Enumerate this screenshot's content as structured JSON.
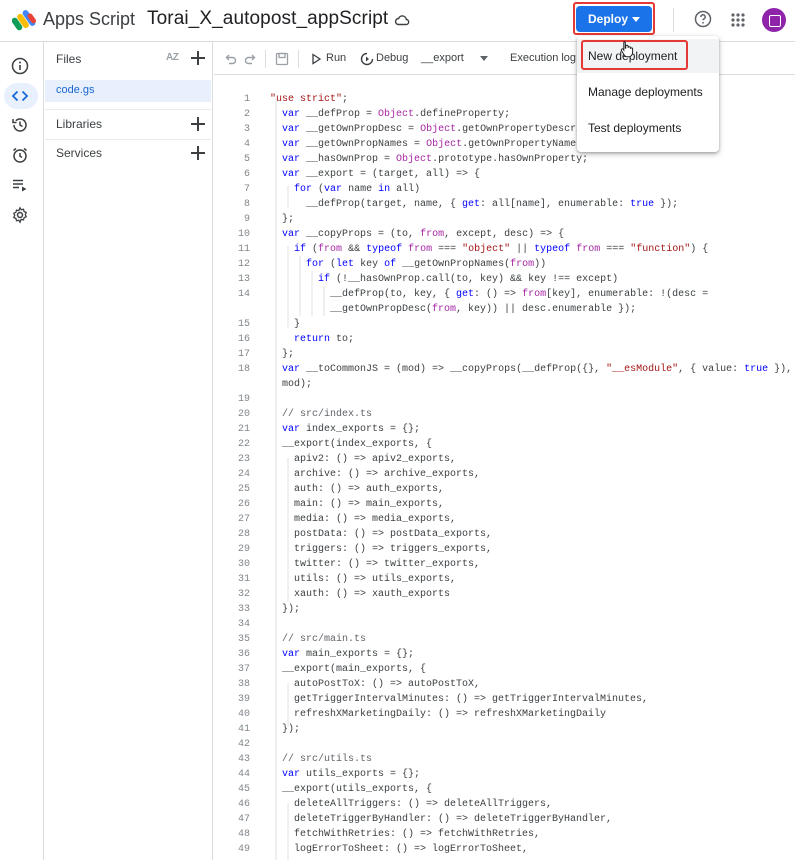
{
  "header": {
    "app_name": "Apps Script",
    "project_title": "Torai_X_autopost_appScript",
    "deploy_label": "Deploy"
  },
  "deploy_menu": {
    "items": [
      "New deployment",
      "Manage deployments",
      "Test deployments"
    ]
  },
  "files_panel": {
    "files_label": "Files",
    "sort_label": "AZ",
    "files": [
      "code.gs"
    ],
    "libraries_label": "Libraries",
    "services_label": "Services"
  },
  "toolbar": {
    "run_label": "Run",
    "debug_label": "Debug",
    "function_selected": "__export",
    "execution_log_label": "Execution log"
  },
  "editor": {
    "lines": [
      {
        "n": "1",
        "t": "\"use strict\";"
      },
      {
        "n": "2",
        "t": "  var __defProp = Object.defineProperty;"
      },
      {
        "n": "3",
        "t": "  var __getOwnPropDesc = Object.getOwnPropertyDescrip"
      },
      {
        "n": "4",
        "t": "  var __getOwnPropNames = Object.getOwnPropertyNames"
      },
      {
        "n": "5",
        "t": "  var __hasOwnProp = Object.prototype.hasOwnProperty;"
      },
      {
        "n": "6",
        "t": "  var __export = (target, all) => {"
      },
      {
        "n": "7",
        "t": "    for (var name in all)"
      },
      {
        "n": "8",
        "t": "      __defProp(target, name, { get: all[name], enumerable: true });"
      },
      {
        "n": "9",
        "t": "  };"
      },
      {
        "n": "10",
        "t": "  var __copyProps = (to, from, except, desc) => {"
      },
      {
        "n": "11",
        "t": "    if (from && typeof from === \"object\" || typeof from === \"function\") {"
      },
      {
        "n": "12",
        "t": "      for (let key of __getOwnPropNames(from))"
      },
      {
        "n": "13",
        "t": "        if (!__hasOwnProp.call(to, key) && key !== except)"
      },
      {
        "n": "14",
        "t": "          __defProp(to, key, { get: () => from[key], enumerable: !(desc ="
      },
      {
        "n": "",
        "t": "          __getOwnPropDesc(from, key)) || desc.enumerable });"
      },
      {
        "n": "15",
        "t": "    }"
      },
      {
        "n": "16",
        "t": "    return to;"
      },
      {
        "n": "17",
        "t": "  };"
      },
      {
        "n": "18",
        "t": "  var __toCommonJS = (mod) => __copyProps(__defProp({}, \"__esModule\", { value: true }),"
      },
      {
        "n": "",
        "t": "  mod);"
      },
      {
        "n": "19",
        "t": ""
      },
      {
        "n": "20",
        "t": "  // src/index.ts"
      },
      {
        "n": "21",
        "t": "  var index_exports = {};"
      },
      {
        "n": "22",
        "t": "  __export(index_exports, {"
      },
      {
        "n": "23",
        "t": "    apiv2: () => apiv2_exports,"
      },
      {
        "n": "24",
        "t": "    archive: () => archive_exports,"
      },
      {
        "n": "25",
        "t": "    auth: () => auth_exports,"
      },
      {
        "n": "26",
        "t": "    main: () => main_exports,"
      },
      {
        "n": "27",
        "t": "    media: () => media_exports,"
      },
      {
        "n": "28",
        "t": "    postData: () => postData_exports,"
      },
      {
        "n": "29",
        "t": "    triggers: () => triggers_exports,"
      },
      {
        "n": "30",
        "t": "    twitter: () => twitter_exports,"
      },
      {
        "n": "31",
        "t": "    utils: () => utils_exports,"
      },
      {
        "n": "32",
        "t": "    xauth: () => xauth_exports"
      },
      {
        "n": "33",
        "t": "  });"
      },
      {
        "n": "34",
        "t": ""
      },
      {
        "n": "35",
        "t": "  // src/main.ts"
      },
      {
        "n": "36",
        "t": "  var main_exports = {};"
      },
      {
        "n": "37",
        "t": "  __export(main_exports, {"
      },
      {
        "n": "38",
        "t": "    autoPostToX: () => autoPostToX,"
      },
      {
        "n": "39",
        "t": "    getTriggerIntervalMinutes: () => getTriggerIntervalMinutes,"
      },
      {
        "n": "40",
        "t": "    refreshXMarketingDaily: () => refreshXMarketingDaily"
      },
      {
        "n": "41",
        "t": "  });"
      },
      {
        "n": "42",
        "t": ""
      },
      {
        "n": "43",
        "t": "  // src/utils.ts"
      },
      {
        "n": "44",
        "t": "  var utils_exports = {};"
      },
      {
        "n": "45",
        "t": "  __export(utils_exports, {"
      },
      {
        "n": "46",
        "t": "    deleteAllTriggers: () => deleteAllTriggers,"
      },
      {
        "n": "47",
        "t": "    deleteTriggerByHandler: () => deleteTriggerByHandler,"
      },
      {
        "n": "48",
        "t": "    fetchWithRetries: () => fetchWithRetries,"
      },
      {
        "n": "49",
        "t": "    logErrorToSheet: () => logErrorToSheet,"
      }
    ]
  },
  "colors": {
    "accent": "#1a73e8",
    "highlight_outline": "#e53935",
    "selected_bg": "#e8f0fe",
    "string": "#a31515",
    "keyword": "#0000ff",
    "builtin": "#a626a4",
    "comment": "#5f6368"
  }
}
